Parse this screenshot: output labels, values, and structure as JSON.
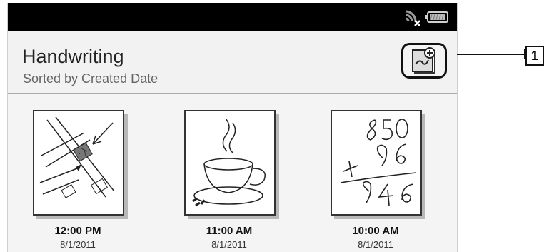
{
  "status_bar": {
    "icons": [
      "wifi-off-icon",
      "battery-icon"
    ]
  },
  "header": {
    "title": "Handwriting",
    "subtitle": "Sorted by Created Date",
    "new_button_icon": "new-handwriting-icon"
  },
  "notes": [
    {
      "time": "12:00 PM",
      "date": "8/1/2011",
      "thumbnail": "map-sketch"
    },
    {
      "time": "11:00 AM",
      "date": "8/1/2011",
      "thumbnail": "coffee-cup-sketch"
    },
    {
      "time": "10:00 AM",
      "date": "8/1/2011",
      "thumbnail": "math-addition-sketch"
    }
  ],
  "callout": {
    "label": "1"
  }
}
